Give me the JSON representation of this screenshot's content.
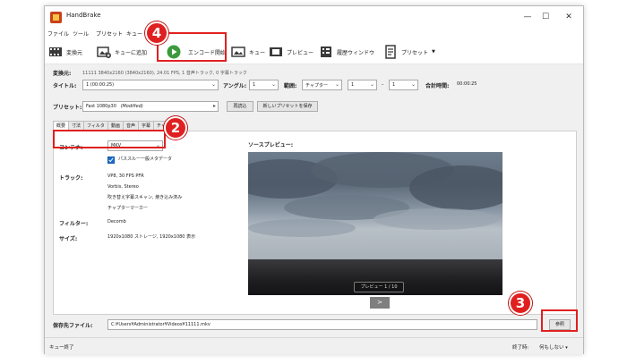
{
  "window": {
    "title": "HandBrake"
  },
  "menu": [
    "ファイル",
    "ツール",
    "プリセット",
    "キュー"
  ],
  "toolbar": {
    "source": "変換元",
    "add_queue": "キューに追加",
    "start": "エンコード開始",
    "queue": "キュー",
    "preview": "プレビュー",
    "activity": "履歴ウィンドウ",
    "presets": "プリセット"
  },
  "source_info": {
    "label": "変換元:",
    "text": "11111 3840x2160 (3840x2160), 24.01 FPS, 1 音声トラック, 0 字幕トラック"
  },
  "title_row": {
    "title_label": "タイトル:",
    "title_value": "1 (00:00:25)",
    "angle_label": "アングル:",
    "angle_value": "1",
    "range_label": "範囲:",
    "range_value": "チャプター",
    "range_from": "1",
    "range_dash": "-",
    "range_to": "1",
    "duration_label": "合計時間:",
    "duration_value": "00:00:25"
  },
  "preset_row": {
    "label": "プリセット:",
    "value": "Fast 1080p30",
    "modified": "(Modified)",
    "reload": "再読込",
    "save_new": "新しいプリセットを保存"
  },
  "tabs": [
    "概要",
    "寸法",
    "フィルタ",
    "動画",
    "音声",
    "字幕",
    "チャプター"
  ],
  "summary": {
    "container_label": "コンテナ:",
    "container_value": "MKV",
    "passthru": "パススルー一般メタデータ",
    "tracks_label": "トラック:",
    "tracks": [
      "VP8, 30 FPS PFR",
      "Vorbis, Stereo",
      "吹き替え字幕スキャン, 焼き込み済み",
      "チャプターマーカー"
    ],
    "filters_label": "フィルター:",
    "filters_value": "Decomb",
    "size_label": "サイズ:",
    "size_value": "1920x1080 ストレージ, 1920x1080 表示",
    "preview_label": "ソースプレビュー:",
    "preview_caption": "プレビュー 1 / 10",
    "preview_next": ">"
  },
  "save": {
    "label": "保存先ファイル:",
    "path": "C:¥Users¥Administrator¥Videos¥11111.mkv",
    "browse": "参照"
  },
  "status": {
    "left": "キュー終了",
    "when_done_label": "終了時:",
    "when_done_value": "何もしない"
  },
  "callouts": [
    "4",
    "2",
    "3"
  ],
  "colors": {
    "accent": "#e02020",
    "start_green": "#3c9a3c"
  }
}
